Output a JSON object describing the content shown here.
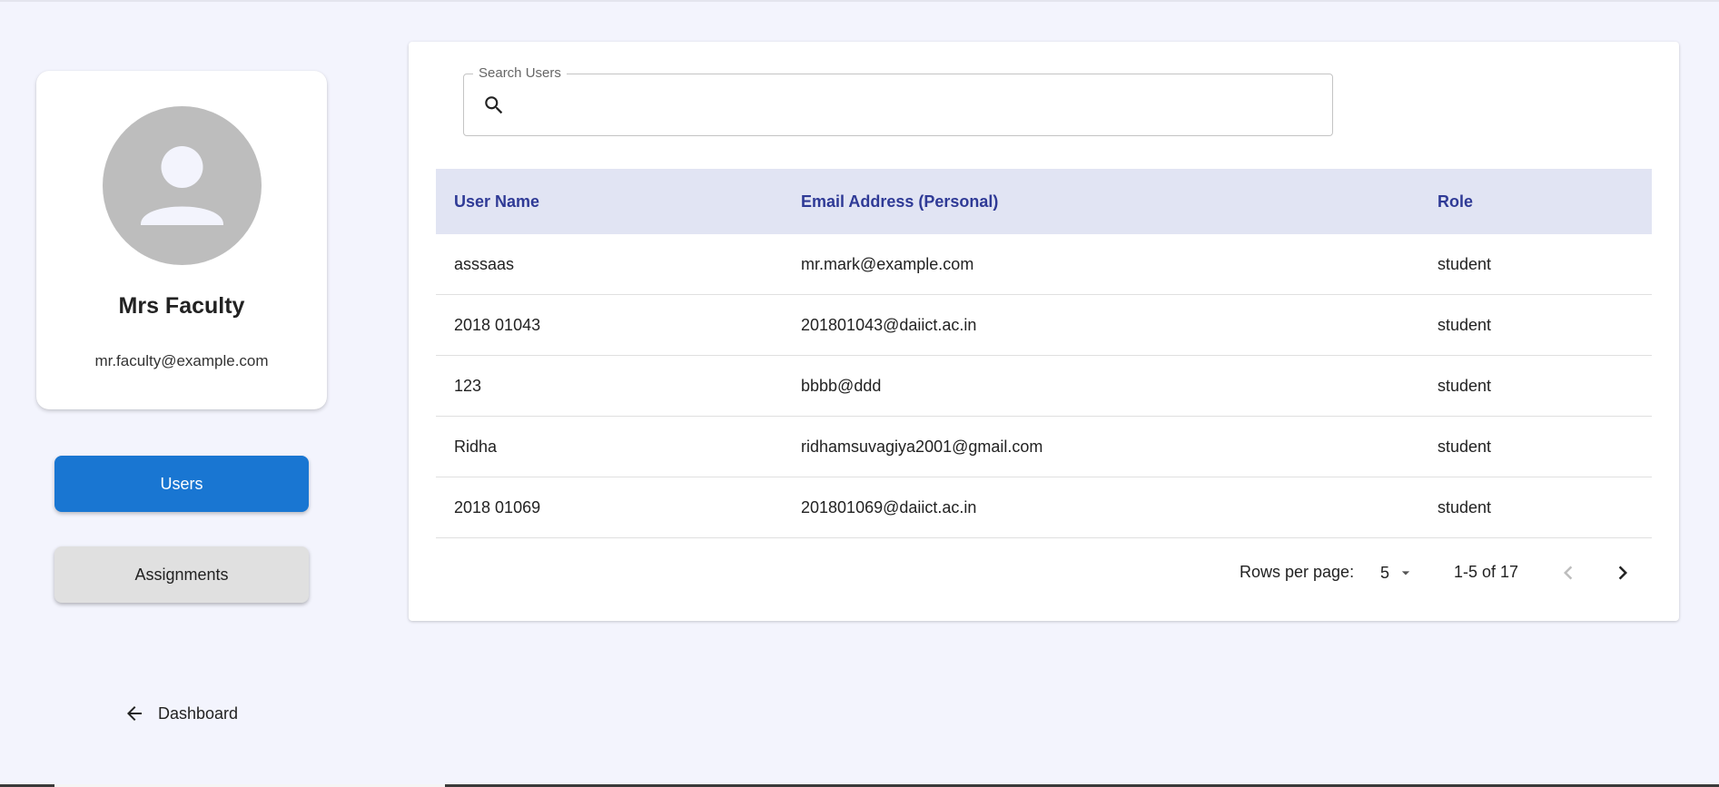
{
  "profile": {
    "name": "Mrs Faculty",
    "email": "mr.faculty@example.com"
  },
  "nav": {
    "users_label": "Users",
    "assignments_label": "Assignments",
    "dashboard_label": "Dashboard"
  },
  "search": {
    "label": "Search Users",
    "value": ""
  },
  "table": {
    "headers": [
      "User Name",
      "Email Address (Personal)",
      "Role"
    ],
    "rows": [
      [
        "asssaas",
        "mr.mark@example.com",
        "student"
      ],
      [
        "2018 01043",
        "201801043@daiict.ac.in",
        "student"
      ],
      [
        "123",
        "bbbb@ddd",
        "student"
      ],
      [
        "Ridha",
        "ridhamsuvagiya2001@gmail.com",
        "student"
      ],
      [
        "2018 01069",
        "201801069@daiict.ac.in",
        "student"
      ]
    ]
  },
  "pagination": {
    "rows_per_page_label": "Rows per page:",
    "rows_per_page": "5",
    "range": "1-5 of 17"
  },
  "colors": {
    "primary": "#1976d2",
    "header_bg": "#e1e4f3",
    "header_text": "#2f3a96",
    "page_bg": "#f3f4fd"
  }
}
